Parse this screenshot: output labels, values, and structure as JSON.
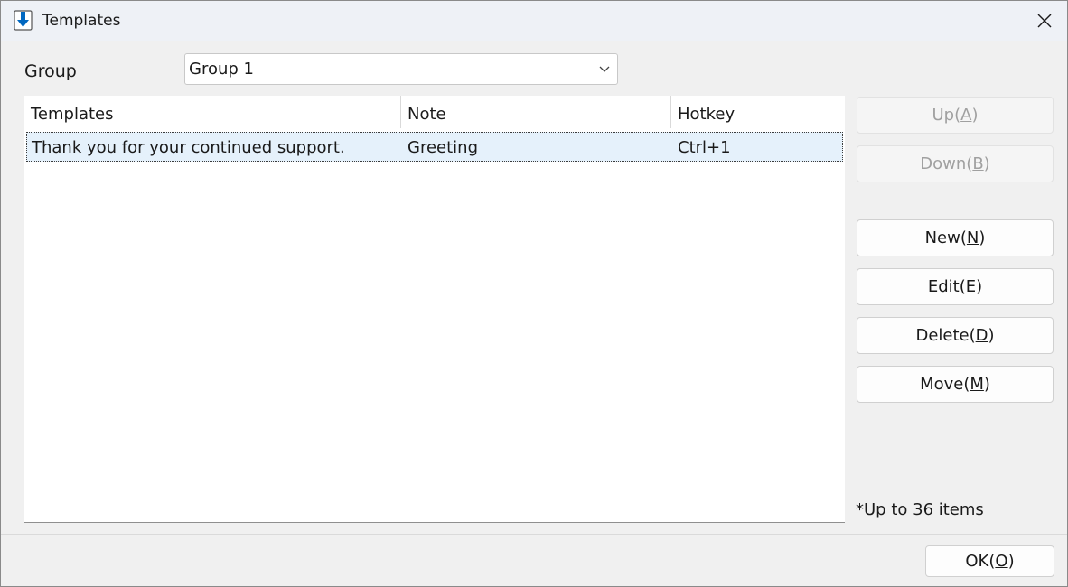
{
  "window": {
    "title": "Templates",
    "icon": "download-arrow-icon",
    "accent_color": "#0067c0"
  },
  "group": {
    "label": "Group",
    "selected": "Group 1"
  },
  "table": {
    "columns": [
      "Templates",
      "Note",
      "Hotkey"
    ],
    "rows": [
      {
        "template": "Thank you for your continued support.",
        "note": "Greeting",
        "hotkey": "Ctrl+1"
      }
    ]
  },
  "buttons": {
    "up": {
      "text": "Up(",
      "key": "A",
      "end": ")",
      "enabled": false
    },
    "down": {
      "text": "Down(",
      "key": "B",
      "end": ")",
      "enabled": false
    },
    "new": {
      "text": "New(",
      "key": "N",
      "end": ")",
      "enabled": true
    },
    "edit": {
      "text": "Edit(",
      "key": "E",
      "end": ")",
      "enabled": true
    },
    "delete": {
      "text": "Delete(",
      "key": "D",
      "end": ")",
      "enabled": true
    },
    "move": {
      "text": "Move(",
      "key": "M",
      "end": ")",
      "enabled": true
    },
    "ok": {
      "text": "OK(",
      "key": "O",
      "end": ")",
      "enabled": true
    }
  },
  "limit_note": "*Up to 36 items"
}
